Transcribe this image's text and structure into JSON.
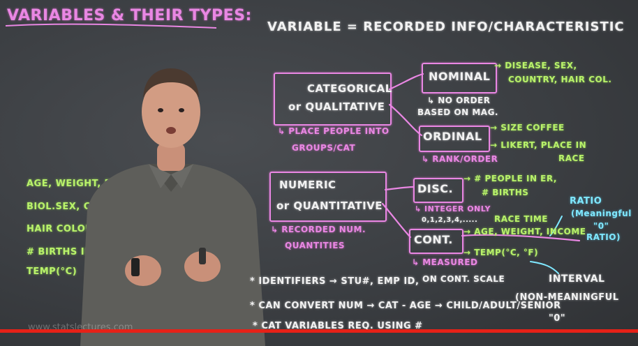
{
  "title": "VARIABLES & THEIR TYPES:",
  "definition": "VARIABLE = RECORDED INFO/CHARACTERISTIC",
  "categorical": {
    "line1": "CATEGORICAL",
    "line2": "or QUALITATIVE",
    "note1": "↳ PLACE PEOPLE INTO",
    "note2": "GROUPS/CAT"
  },
  "nominal": {
    "label": "NOMINAL",
    "examples1": "→ DISEASE, SEX,",
    "examples2": "COUNTRY, HAIR COL.",
    "note1": "↳ NO ORDER",
    "note2": "BASED ON MAG."
  },
  "ordinal": {
    "label": "ORDINAL",
    "ex1": "→ SIZE COFFEE",
    "ex2": "→ LIKERT, PLACE IN",
    "ex3": "RACE",
    "note": "↳ RANK/ORDER"
  },
  "numeric": {
    "line1": "NUMERIC",
    "line2": "or QUANTITATIVE",
    "note1": "↳ RECORDED NUM.",
    "note2": "QUANTITIES"
  },
  "discrete": {
    "label": "DISC.",
    "ex1": "→ # PEOPLE IN ER,",
    "ex2": "# BIRTHS",
    "note1": "↳ INTEGER ONLY",
    "note2": "0,1,2,3,4,....."
  },
  "continuous": {
    "label": "CONT.",
    "race_time": "RACE TIME",
    "ex1": "→ AGE, WEIGHT, INCOME",
    "ex2": "→ TEMP(°C, °F)",
    "note1": "↳ MEASURED",
    "note2": "ON CONT. SCALE"
  },
  "ratio": {
    "line1": "RATIO",
    "line2": "(Meaningful",
    "line3": "\"0\"",
    "line4": "RATIO)"
  },
  "interval": {
    "line1": "INTERVAL",
    "line2": "(NON-MEANINGFUL",
    "line3": "\"0\""
  },
  "left_list": [
    "AGE, WEIGHT, BMI, DISEASE(Y/N)",
    "BIOL.SEX, COUNTRY BIRTH,",
    "HAIR COLOUR, INCOME, # PEOPLE IN E.R.,",
    "# BIRTHS IN DAY, SIZE COFFEE(S/M/L),",
    "TEMP(°C)"
  ],
  "bottom_notes": [
    "* IDENTIFIERS → STU#, EMP ID,",
    "* CAN CONVERT NUM → CAT - AGE → CHILD/ADULT/SENIOR",
    "* CAT VARIABLES REQ. USING #"
  ],
  "watermark": "www.statslectures.com",
  "video": {
    "progress_fraction": 1.0
  },
  "colors": {
    "board": "#3b3e42",
    "pink": "#e987e3",
    "green": "#b9f26a",
    "white": "#f2f2f2",
    "cyan": "#7fe8ff",
    "progress": "#e62117"
  }
}
